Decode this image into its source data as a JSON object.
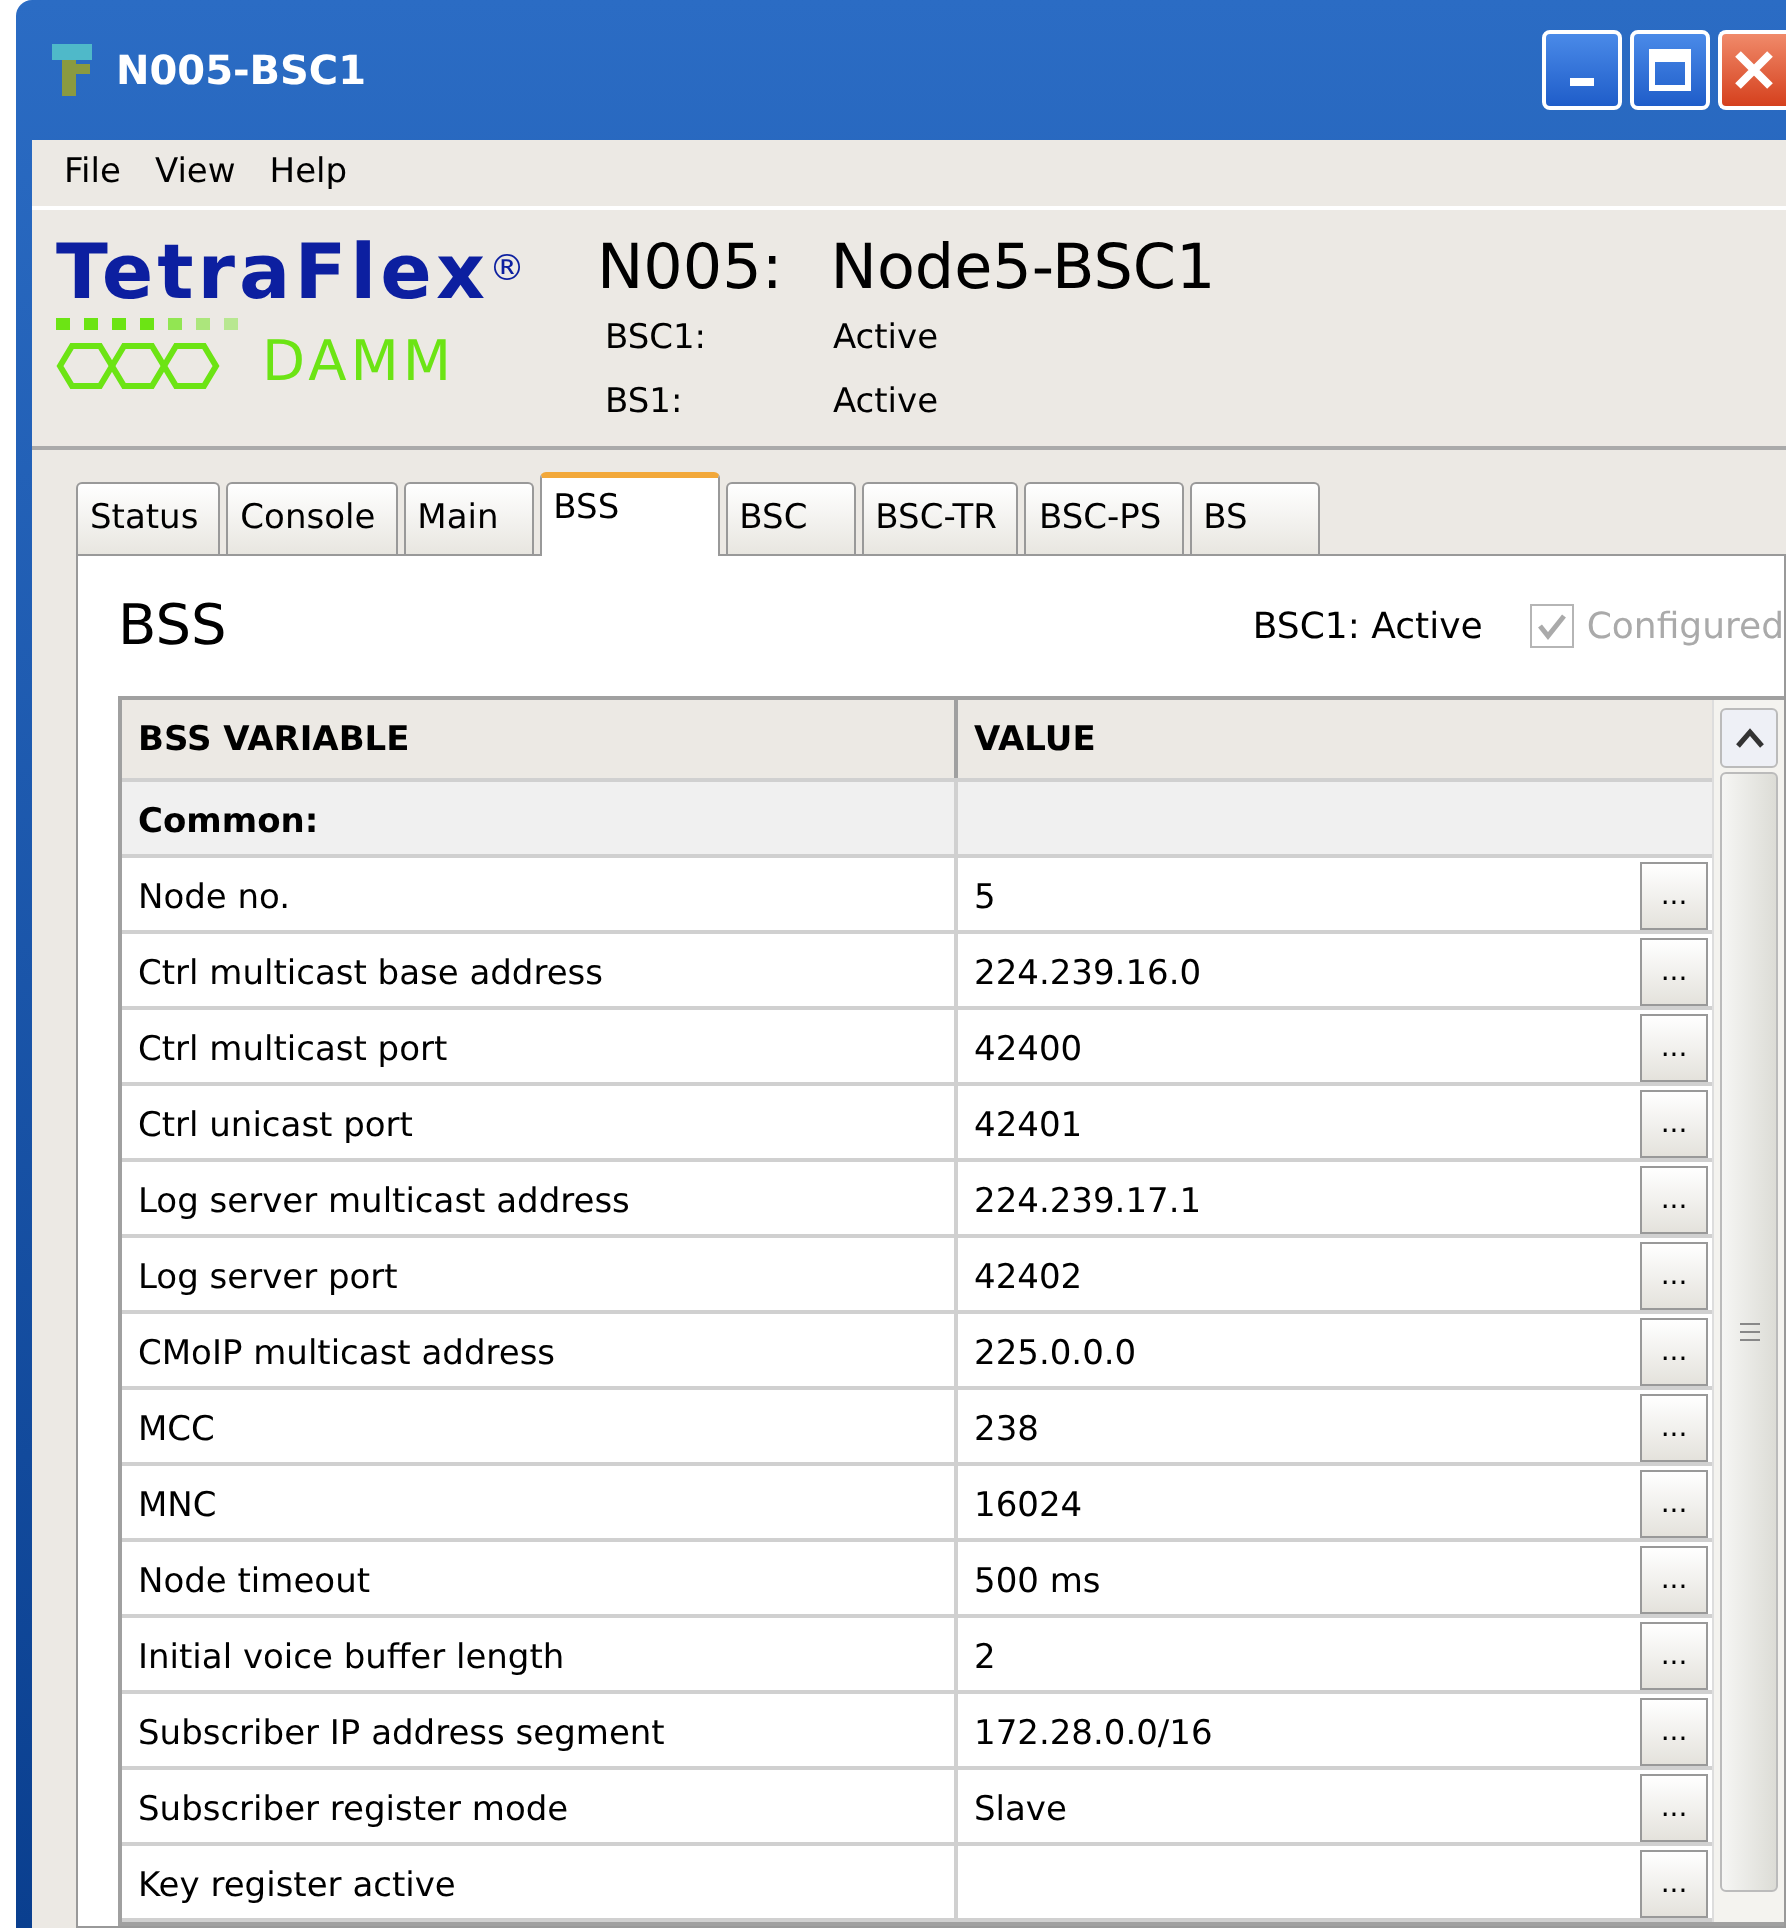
{
  "window": {
    "title": "N005-BSC1"
  },
  "menu": [
    "File",
    "View",
    "Help"
  ],
  "header": {
    "logo": "TetraFlex$^{®}$",
    "logo_sub": "DAMM",
    "node_id": "N005:",
    "node_name": "Node5-BSC1",
    "status": [
      {
        "label": "BSC1:",
        "value": "Active"
      },
      {
        "label": "BS1:",
        "value": "Active"
      }
    ]
  },
  "tabs": [
    {
      "label": "Status",
      "selected": false
    },
    {
      "label": "Console",
      "selected": false
    },
    {
      "label": "Main",
      "selected": false
    },
    {
      "label": "BSS",
      "selected": true
    },
    {
      "label": "BSC",
      "selected": false
    },
    {
      "label": "BSC-TR",
      "selected": false
    },
    {
      "label": "BSC-PS",
      "selected": false
    },
    {
      "label": "BS",
      "selected": false
    }
  ],
  "panel": {
    "title": "BSS",
    "state": "BSC1: Active",
    "configured": {
      "label": "Configured",
      "checked": true,
      "disabled": true
    }
  },
  "table": {
    "columns": [
      "BSS VARIABLE",
      "VALUE"
    ],
    "rows": [
      {
        "kind": "group",
        "variable": "Common:"
      },
      {
        "kind": "item",
        "variable": "Node no.",
        "value": "5",
        "button": "..."
      },
      {
        "kind": "item",
        "variable": "Ctrl multicast base address",
        "value": "224.239.16.0",
        "button": "..."
      },
      {
        "kind": "item",
        "variable": "Ctrl multicast port",
        "value": "42400",
        "button": "..."
      },
      {
        "kind": "item",
        "variable": "Ctrl unicast port",
        "value": "42401",
        "button": "..."
      },
      {
        "kind": "item",
        "variable": "Log server multicast address",
        "value": "224.239.17.1",
        "button": "..."
      },
      {
        "kind": "item",
        "variable": "Log server port",
        "value": "42402",
        "button": "..."
      },
      {
        "kind": "item",
        "variable": "CMoIP multicast address",
        "value": "225.0.0.0",
        "button": "..."
      },
      {
        "kind": "item",
        "variable": "MCC",
        "value": "238",
        "button": "..."
      },
      {
        "kind": "item",
        "variable": "MNC",
        "value": "16024",
        "button": "..."
      },
      {
        "kind": "item",
        "variable": "Node timeout",
        "value": "500 ms",
        "button": "..."
      },
      {
        "kind": "item",
        "variable": "Initial voice buffer length",
        "value": "2",
        "button": "..."
      },
      {
        "kind": "item",
        "variable": "Subscriber IP address segment",
        "value": "172.28.0.0/16",
        "button": "..."
      },
      {
        "kind": "item",
        "variable": "Subscriber register mode",
        "value": "Slave",
        "button": "..."
      },
      {
        "kind": "item",
        "variable": "Key register active",
        "button": "..."
      }
    ]
  }
}
